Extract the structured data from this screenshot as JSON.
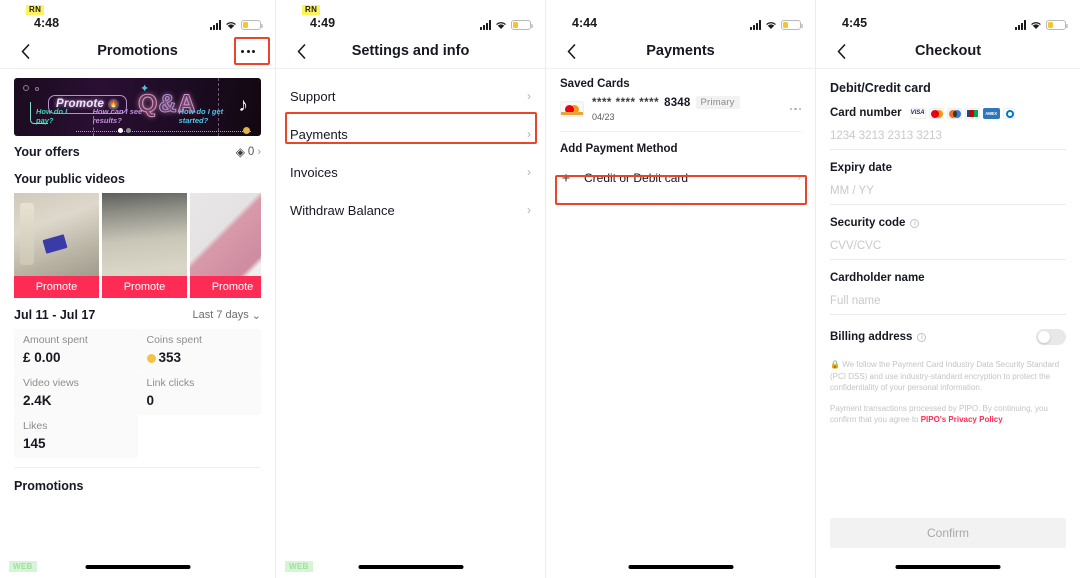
{
  "panels": [
    {
      "status": {
        "badge": "RN",
        "time": "4:48"
      },
      "nav": {
        "title": "Promotions",
        "back_icon": "chevron-left-icon",
        "more_icon": "more-horizontal-icon"
      },
      "banner": {
        "promote_label": "Promote",
        "qa_q": "Q",
        "qa_amp": "&",
        "qa_a": "A",
        "q1": "How do I pay?",
        "q2": "How can I see results?",
        "q3": "How do I get started?"
      },
      "offers": {
        "label": "Your offers",
        "count": "0"
      },
      "videos": {
        "heading": "Your public videos",
        "items": [
          {
            "promote_label": "Promote"
          },
          {
            "promote_label": "Promote"
          },
          {
            "promote_label": "Promote"
          }
        ]
      },
      "date": {
        "range": "Jul 11 - Jul 17",
        "selector": "Last 7 days"
      },
      "stats": [
        {
          "key": "Amount spent",
          "value": "£ 0.00",
          "coin": false
        },
        {
          "key": "Coins spent",
          "value": "353",
          "coin": true
        },
        {
          "key": "Video views",
          "value": "2.4K",
          "coin": false
        },
        {
          "key": "Link clicks",
          "value": "0",
          "coin": false
        },
        {
          "key": "Likes",
          "value": "145",
          "coin": false
        }
      ],
      "bottom_section": "Promotions",
      "web_badge": "WEB"
    },
    {
      "status": {
        "badge": "RN",
        "time": "4:49"
      },
      "nav": {
        "title": "Settings and info"
      },
      "items": [
        {
          "label": "Support",
          "highlighted": false
        },
        {
          "label": "Payments",
          "highlighted": true
        },
        {
          "label": "Invoices",
          "highlighted": false
        },
        {
          "label": "Withdraw Balance",
          "highlighted": false
        }
      ],
      "web_badge": "WEB"
    },
    {
      "status": {
        "time": "4:44"
      },
      "nav": {
        "title": "Payments"
      },
      "saved_cards_heading": "Saved Cards",
      "card": {
        "brand": "mastercard-logo",
        "mask": "**** **** ****",
        "last4": "8348",
        "badge": "Primary",
        "expiry": "04/23"
      },
      "add_heading": "Add Payment Method",
      "add_row": {
        "label": "Credit or Debit card",
        "highlighted": true
      }
    },
    {
      "status": {
        "time": "4:45"
      },
      "nav": {
        "title": "Checkout"
      },
      "section_title": "Debit/Credit card",
      "card_number": {
        "label": "Card number",
        "placeholder": "1234 3213 2313 3213",
        "brands": [
          "visa",
          "mastercard",
          "maestro",
          "jcb",
          "amex",
          "diners"
        ]
      },
      "expiry": {
        "label": "Expiry date",
        "placeholder": "MM / YY"
      },
      "security": {
        "label": "Security code",
        "placeholder": "CVV/CVC"
      },
      "cardholder": {
        "label": "Cardholder name",
        "placeholder": "Full name"
      },
      "billing": {
        "label": "Billing address",
        "toggle_on": false
      },
      "legal1": "We follow the Payment Card Industry Data Security Standard (PCI DSS) and use industry-standard encryption to protect the confidentiality of your personal information.",
      "legal2_pre": "Payment transactions processed by PIPO. By continuing, you confirm that you agree to ",
      "legal2_link": "PIPO's Privacy Policy",
      "legal2_post": ".",
      "confirm_label": "Confirm"
    }
  ],
  "colors": {
    "accent": "#fe2c55",
    "highlight": "#e8452c",
    "battery": "#f5c531"
  }
}
